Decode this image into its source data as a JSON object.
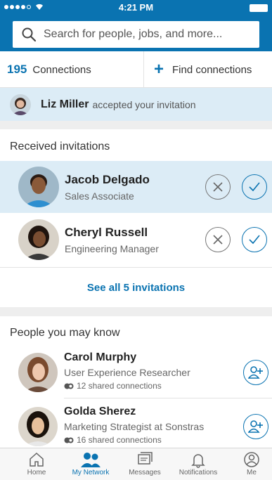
{
  "status_bar": {
    "time": "4:21 PM"
  },
  "search": {
    "placeholder": "Search for people, jobs, and more..."
  },
  "connections": {
    "count": "195",
    "label": "Connections",
    "find_label": "Find connections"
  },
  "banner": {
    "name": "Liz Miller",
    "text": "accepted your invitation"
  },
  "invitations": {
    "title": "Received invitations",
    "items": [
      {
        "name": "Jacob Delgado",
        "title": "Sales Associate"
      },
      {
        "name": "Cheryl Russell",
        "title": "Engineering Manager"
      }
    ],
    "see_all": "See all 5 invitations"
  },
  "pymk": {
    "title": "People you may know",
    "items": [
      {
        "name": "Carol Murphy",
        "title": "User Experience Researcher",
        "shared": "12 shared connections"
      },
      {
        "name": "Golda Sherez",
        "title": "Marketing Strategist at Sonstras",
        "shared": "16 shared connections"
      }
    ]
  },
  "tabs": [
    {
      "label": "Home",
      "icon": "home-icon"
    },
    {
      "label": "My Network",
      "icon": "network-icon",
      "active": true
    },
    {
      "label": "Messages",
      "icon": "messages-icon"
    },
    {
      "label": "Notifications",
      "icon": "bell-icon"
    },
    {
      "label": "Me",
      "icon": "me-icon"
    }
  ],
  "colors": {
    "brand": "#0a73b1",
    "highlight": "#dcecf6"
  }
}
